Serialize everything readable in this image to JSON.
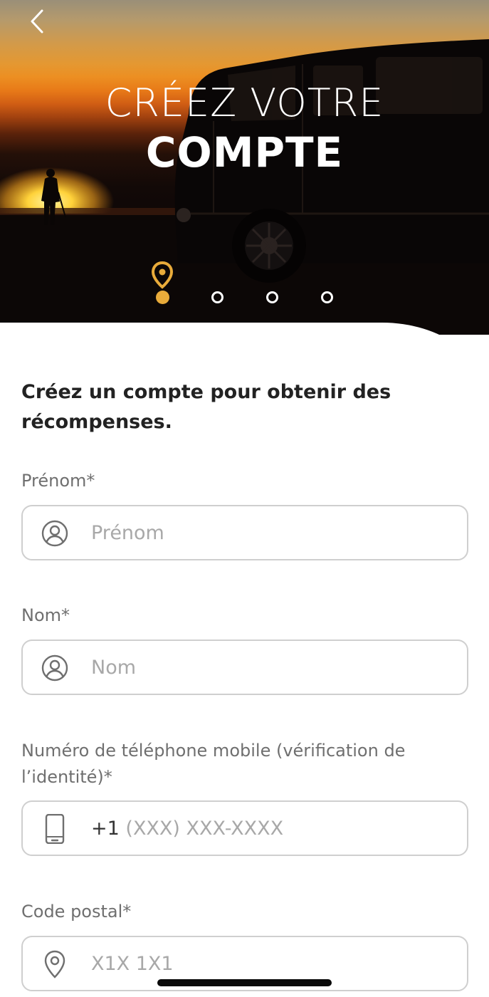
{
  "header": {
    "back_label": "back",
    "title_line1": "CRÉEZ VOTRE",
    "title_line2": "COMPTE"
  },
  "stepper": {
    "current_step": 1,
    "total_steps": 4,
    "active_color": "#e9ab3a"
  },
  "form": {
    "intro": "Créez un compte pour obtenir des récompenses.",
    "first_name": {
      "label": "Prénom*",
      "placeholder": "Prénom",
      "icon": "user-circle-icon"
    },
    "last_name": {
      "label": "Nom*",
      "placeholder": "Nom",
      "icon": "user-circle-icon"
    },
    "phone": {
      "label": "Numéro de téléphone mobile (vérification de l’identité)*",
      "prefix": "+1",
      "placeholder": "(XXX) XXX-XXXX",
      "icon": "phone-icon"
    },
    "postal_code": {
      "label": "Code postal*",
      "placeholder": "X1X 1X1",
      "icon": "location-pin-icon"
    }
  },
  "colors": {
    "accent": "#e9ab3a",
    "field_border": "#cfcfcf",
    "placeholder": "#a8a8a8",
    "label": "#6f6f6f"
  }
}
